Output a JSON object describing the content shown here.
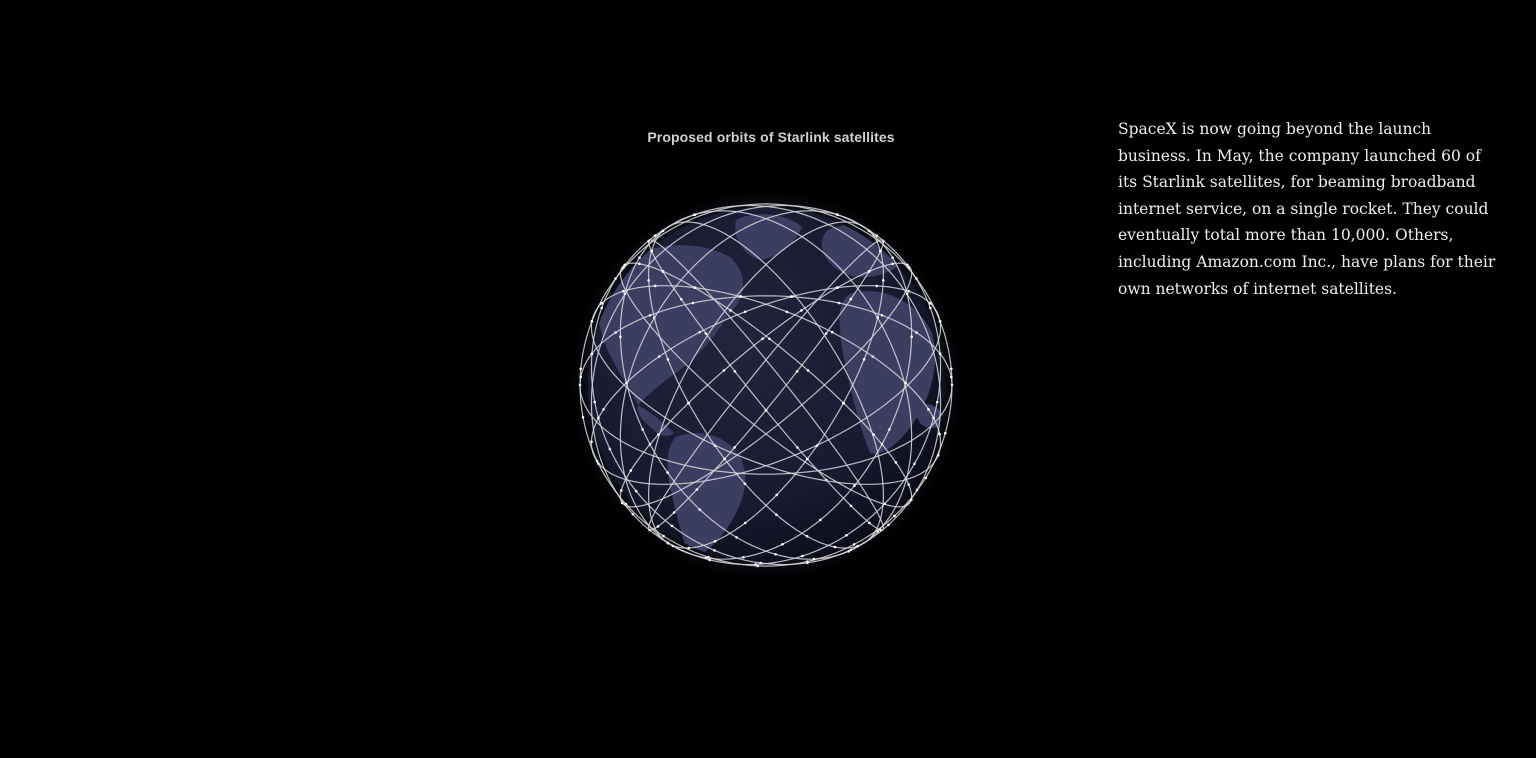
{
  "figure": {
    "title": "Proposed orbits of Starlink satellites"
  },
  "narrative": {
    "text": "SpaceX is now going beyond the launch business. In May, the company launched 60 of its Starlink satellites, for beaming broadband internet service, on a single rocket. They could eventually total more than 10,000. Others, including Amazon.com Inc., have plans for their own networks of internet satellites."
  },
  "colors": {
    "background": "#000000",
    "globe_ocean": "#1b1c33",
    "land": "#3d3f63",
    "orbit_lines": "#d9d9de",
    "text": "#eeeeee"
  },
  "icons": {
    "globe": "earth-globe-icon"
  }
}
